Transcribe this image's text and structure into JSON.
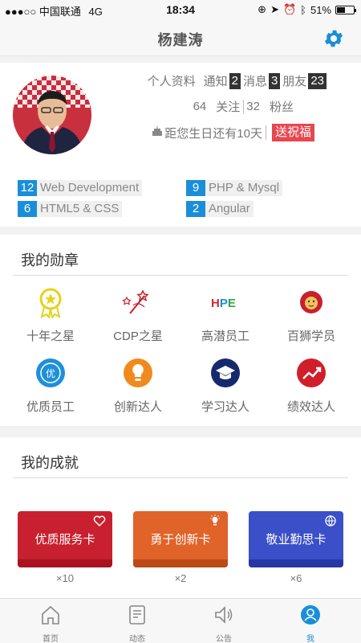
{
  "status_bar": {
    "carrier": "●●●○○ 中国联通",
    "network": "4G",
    "time": "18:34",
    "battery": "51%",
    "battery_level": 0.51
  },
  "header": {
    "title": "杨建涛",
    "settings_icon": "gear-icon",
    "accent_color": "#1a8ed8"
  },
  "profile": {
    "profile_link": "个人资料",
    "notice_label": "通知",
    "notice_count": "2",
    "message_label": "消息",
    "message_count": "3",
    "friends_label": "朋友",
    "friends_count": "23",
    "following_count": "64",
    "following_label": "关注",
    "fans_count": "32",
    "fans_label": "粉丝",
    "birthday_text": "距您生日还有10天",
    "celebrate_button": "送祝福",
    "skills": [
      {
        "count": "12",
        "label": "Web Development"
      },
      {
        "count": "9",
        "label": "PHP & Mysql"
      },
      {
        "count": "6",
        "label": "HTML5 & CSS"
      },
      {
        "count": "2",
        "label": "Angular"
      }
    ]
  },
  "badges": {
    "title": "我的勋章",
    "items": [
      {
        "label": "十年之星",
        "icon": "medal-icon"
      },
      {
        "label": "CDP之星",
        "icon": "magic-wand-icon"
      },
      {
        "label": "高潜员工",
        "icon": "hpe-logo-icon",
        "logo_text": "HPE"
      },
      {
        "label": "百狮学员",
        "icon": "lion-icon"
      },
      {
        "label": "优质员工",
        "icon": "quality-icon",
        "glyph": "优"
      },
      {
        "label": "创新达人",
        "icon": "lightbulb-icon"
      },
      {
        "label": "学习达人",
        "icon": "graduation-cap-icon"
      },
      {
        "label": "绩效达人",
        "icon": "trend-chart-icon"
      }
    ]
  },
  "achievements": {
    "title": "我的成就",
    "cards": [
      {
        "name": "优质服务卡",
        "count": "×10",
        "color": "#c8202e",
        "stripe": "#a9131f",
        "icon": "heart-icon"
      },
      {
        "name": "勇于创新卡",
        "count": "×2",
        "color": "#e0632a",
        "stripe": "#bb4a17",
        "icon": "lightbulb-icon"
      },
      {
        "name": "敬业勤思卡",
        "count": "×6",
        "color": "#3a4fc8",
        "stripe": "#2636a4",
        "icon": "globe-icon"
      }
    ]
  },
  "tab_bar": {
    "tabs": [
      {
        "label": "首页",
        "icon": "home-icon"
      },
      {
        "label": "动态",
        "icon": "feed-icon"
      },
      {
        "label": "公告",
        "icon": "speaker-icon"
      },
      {
        "label": "我",
        "icon": "user-icon",
        "active": true
      }
    ]
  }
}
